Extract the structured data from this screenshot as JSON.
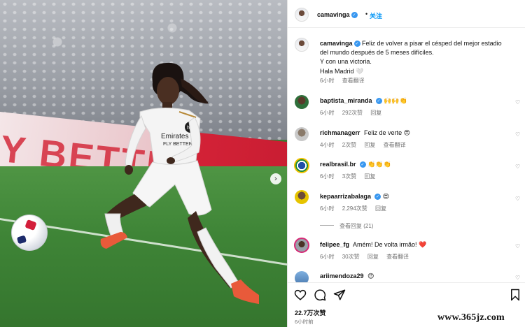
{
  "post": {
    "author": "camavinga",
    "follow_label": "关注",
    "more_icon": "more-dots-icon",
    "verified_icon": "verified-badge-icon",
    "caption_lines": [
      "Feliz de volver a pisar el césped del mejor estadio",
      "del mundo después de 5 meses difíciles.",
      "Y con una victoria.",
      "Hala Madrid 🤍"
    ],
    "caption_time": "6小时",
    "caption_translate": "查看翻译",
    "likes": "22.7万次赞",
    "post_time": "6小时前",
    "watermark": "www.365jz.com"
  },
  "comments": [
    {
      "user": "baptista_miranda",
      "verified": true,
      "text": "🙌🙌👏",
      "time": "6小时",
      "likes": "292次赞",
      "reply": "回复",
      "translate": ""
    },
    {
      "user": "richmanagerr",
      "verified": false,
      "text": "Feliz de verte 😍",
      "time": "4小时",
      "likes": "2次赞",
      "reply": "回复",
      "translate": "查看翻译"
    },
    {
      "user": "realbrasil.br",
      "verified": true,
      "text": "👏👏👏",
      "time": "6小时",
      "likes": "3次赞",
      "reply": "回复",
      "translate": ""
    },
    {
      "user": "kepaarrizabalaga",
      "verified": true,
      "text": "😍",
      "time": "6小时",
      "likes": "2,294次赞",
      "reply": "回复",
      "translate": ""
    },
    {
      "user": "felipee_fg",
      "verified": false,
      "text": "Amém! De volta irmão! ❤️",
      "time": "6小时",
      "likes": "30次赞",
      "reply": "回复",
      "translate": "查看翻译"
    },
    {
      "user": "ariimendoza29",
      "verified": false,
      "text": "😍",
      "time": "",
      "likes": "",
      "reply": "",
      "translate": ""
    }
  ],
  "view_replies": "查看回复 (21)",
  "photo": {
    "banner_text": "Y BETTER",
    "next_icon": "chevron-right-icon"
  },
  "colors": {
    "accent": "#0095f6",
    "verified": "#3897f0",
    "heart_red": "#ed4956"
  }
}
